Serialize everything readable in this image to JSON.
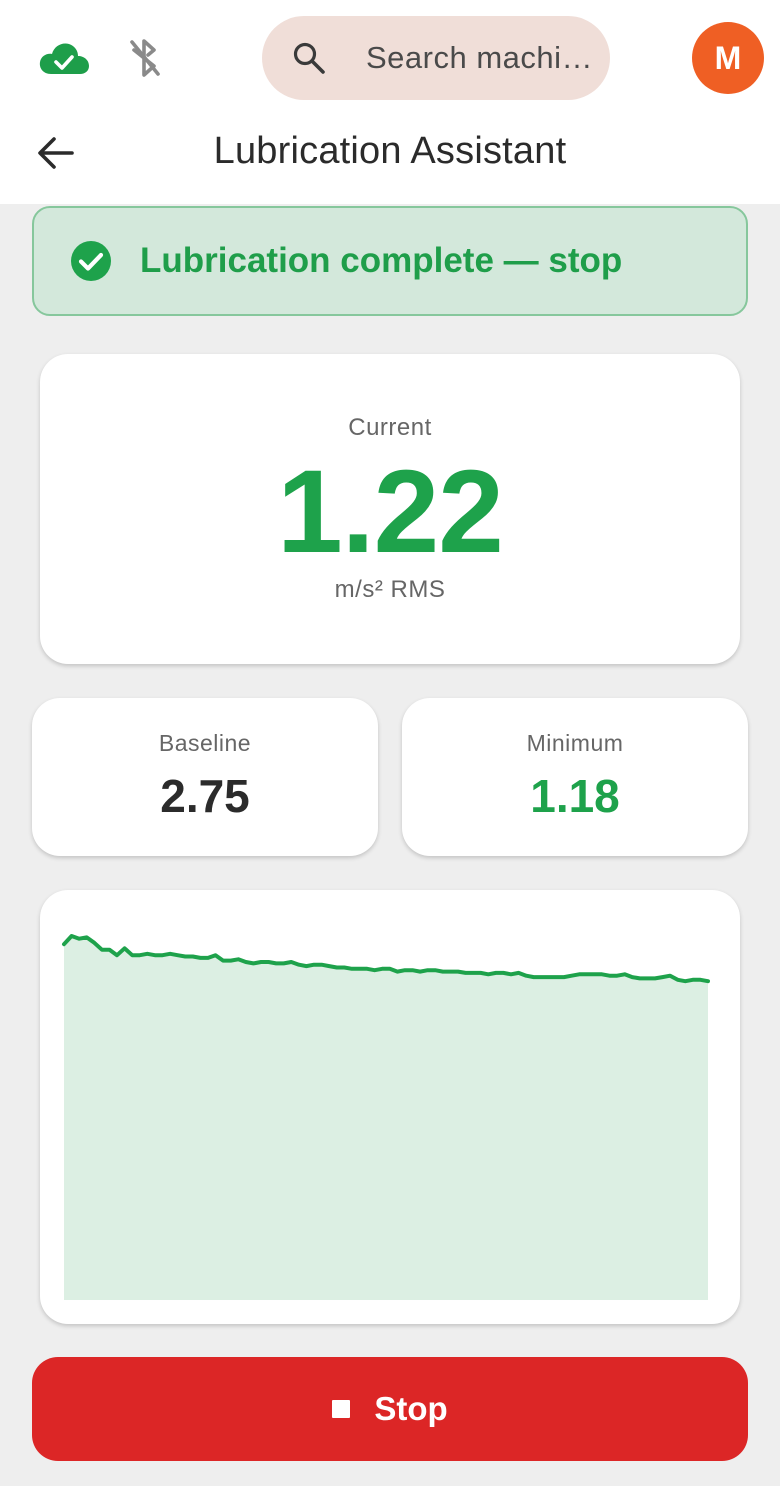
{
  "header": {
    "status_icons": [
      "cloud-check-icon",
      "bluetooth-disabled-icon"
    ],
    "search": {
      "placeholder": "Search machi…"
    },
    "avatar_initial": "M",
    "title": "Lubrication Assistant"
  },
  "banner": {
    "text": "Lubrication complete — stop",
    "icon": "check-circle-icon"
  },
  "current": {
    "label": "Current",
    "value": "1.22",
    "unit": "m/s² RMS"
  },
  "baseline": {
    "label": "Baseline",
    "value": "2.75"
  },
  "minimum": {
    "label": "Minimum",
    "value": "1.18"
  },
  "chart_data": {
    "type": "area",
    "title": "",
    "xlabel": "",
    "ylabel": "",
    "ylim": [
      0,
      2.85
    ],
    "values": [
      2.6,
      2.66,
      2.64,
      2.65,
      2.61,
      2.56,
      2.56,
      2.52,
      2.57,
      2.52,
      2.52,
      2.53,
      2.52,
      2.52,
      2.53,
      2.52,
      2.51,
      2.51,
      2.5,
      2.5,
      2.52,
      2.48,
      2.48,
      2.49,
      2.47,
      2.46,
      2.47,
      2.47,
      2.46,
      2.46,
      2.47,
      2.45,
      2.44,
      2.45,
      2.45,
      2.44,
      2.43,
      2.43,
      2.42,
      2.42,
      2.42,
      2.41,
      2.42,
      2.42,
      2.4,
      2.41,
      2.41,
      2.4,
      2.41,
      2.41,
      2.4,
      2.4,
      2.4,
      2.39,
      2.39,
      2.39,
      2.38,
      2.39,
      2.39,
      2.38,
      2.39,
      2.37,
      2.36,
      2.36,
      2.36,
      2.36,
      2.36,
      2.37,
      2.38,
      2.38,
      2.38,
      2.38,
      2.37,
      2.37,
      2.38,
      2.36,
      2.35,
      2.35,
      2.35,
      2.36,
      2.37,
      2.34,
      2.33,
      2.34,
      2.34,
      2.33
    ],
    "colors": {
      "line": "#1ea24b",
      "fill": "#dcefe3"
    }
  },
  "stop_button": {
    "label": "Stop",
    "icon": "stop-square-icon"
  },
  "colors": {
    "accent_green": "#1ea24b",
    "banner_bg": "#d3e8db",
    "danger_red": "#dc2626",
    "avatar_orange": "#ef5f24",
    "search_bg": "#f0ded8"
  }
}
